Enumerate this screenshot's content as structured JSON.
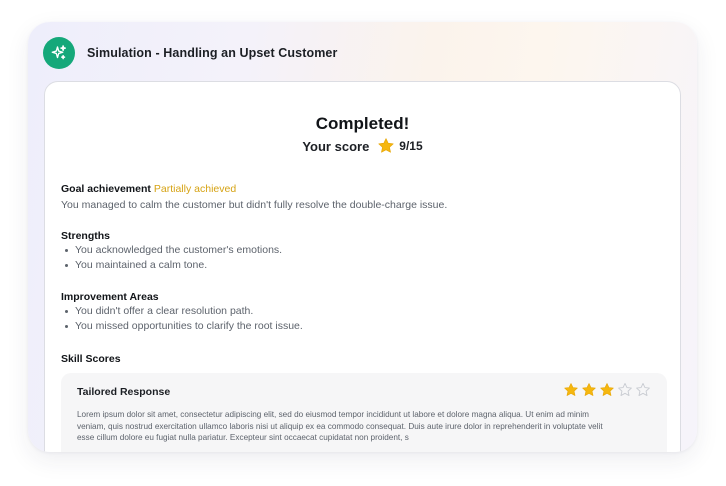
{
  "header": {
    "title": "Simulation - Handling an Upset Customer",
    "icon": "sparkles-icon"
  },
  "result": {
    "title": "Completed!",
    "score_label": "Your score",
    "score_value": "9/15"
  },
  "goal": {
    "label": "Goal achievement",
    "status": "Partially achieved",
    "status_color": "#d6a314",
    "description": "You managed to calm the customer but didn't fully resolve the double-charge issue."
  },
  "strengths": {
    "title": "Strengths",
    "items": [
      "You acknowledged the customer's emotions.",
      "You maintained a calm tone."
    ]
  },
  "improvement": {
    "title": "Improvement Areas",
    "items": [
      "You didn't offer a clear resolution path.",
      "You missed opportunities to clarify the root issue."
    ]
  },
  "skill_scores": {
    "title": "Skill Scores",
    "skills": [
      {
        "name": "Tailored Response",
        "rating": 3,
        "max_rating": 5,
        "description": "Lorem ipsum dolor sit amet, consectetur adipiscing elit, sed do eiusmod tempor incididunt ut labore et dolore magna aliqua. Ut enim ad minim veniam, quis nostrud exercitation ullamco laboris nisi ut aliquip ex ea commodo consequat. Duis aute irure dolor in reprehenderit in voluptate velit esse cillum dolore eu fugiat nulla pariatur. Excepteur sint occaecat cupidatat non proident, s"
      }
    ]
  },
  "colors": {
    "accent_green": "#15a87a",
    "star_filled": "#f5b70f",
    "star_empty": "#c9ccd2",
    "partial_status": "#d6a314"
  }
}
